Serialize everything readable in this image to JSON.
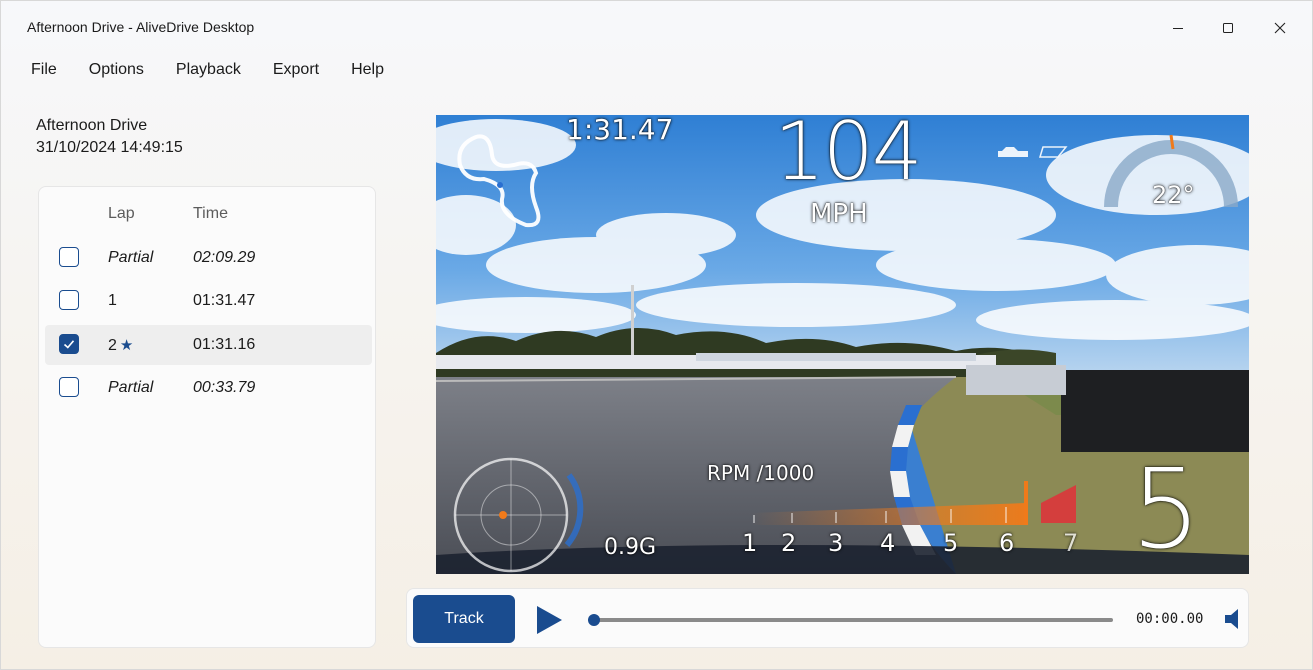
{
  "window": {
    "title": "Afternoon Drive - AliveDrive Desktop",
    "controls": [
      "minimize-icon",
      "maximize-icon",
      "close-icon"
    ]
  },
  "menu": [
    "File",
    "Options",
    "Playback",
    "Export",
    "Help"
  ],
  "session": {
    "name": "Afternoon Drive",
    "datetime": "31/10/2024 14:49:15"
  },
  "laps": {
    "headers": {
      "lap": "Lap",
      "time": "Time"
    },
    "rows": [
      {
        "lap": "Partial",
        "time": "02:09.29",
        "checked": false,
        "best": false,
        "partial": true
      },
      {
        "lap": "1",
        "time": "01:31.47",
        "checked": false,
        "best": false,
        "partial": false
      },
      {
        "lap": "2",
        "time": "01:31.16",
        "checked": true,
        "best": true,
        "partial": false
      },
      {
        "lap": "Partial",
        "time": "00:33.79",
        "checked": false,
        "best": false,
        "partial": true
      }
    ],
    "best_marker": "★"
  },
  "video_overlay": {
    "lap_time": "1:31.47",
    "speed": "104",
    "speed_unit": "MPH",
    "temperature": "22°",
    "rpm_label": "RPM /1000",
    "rpm_ticks": [
      "1",
      "2",
      "3",
      "4",
      "5",
      "6",
      "7"
    ],
    "g_force": "0.9G",
    "gear": "5",
    "rpm_value": 6.3,
    "colors": {
      "rpm_bar": "#f07a1a",
      "redline": "#e0303a",
      "temp_accent": "#f07a1a",
      "g_dot": "#f07a1a"
    }
  },
  "player": {
    "track_button": "Track",
    "time": "00:00.00",
    "progress": 0,
    "icons": {
      "play": "play-icon",
      "volume": "volume-icon"
    },
    "accent": "#1a4c8f"
  }
}
